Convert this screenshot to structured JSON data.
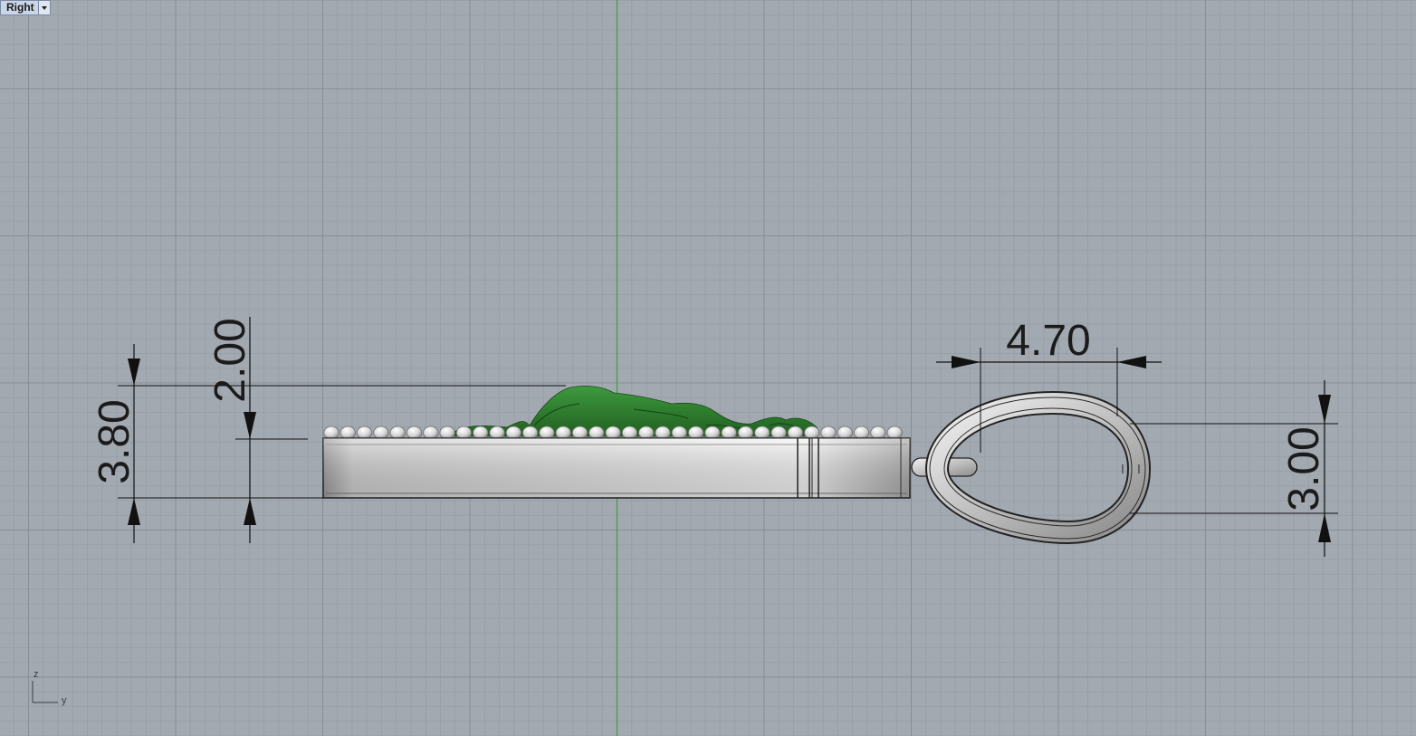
{
  "viewport": {
    "name": "Right",
    "axis_vertical_label": "z",
    "axis_horizontal_label": "y"
  },
  "dimensions": {
    "overall_height": "3.80",
    "relief_height": "2.00",
    "bail_width": "4.70",
    "bail_height": "3.00"
  },
  "colors": {
    "background": "#a3a9b1",
    "axis_green": "#3f9c3f",
    "relief_green": "#2c7d2c",
    "metal": "#d8d8d8"
  }
}
